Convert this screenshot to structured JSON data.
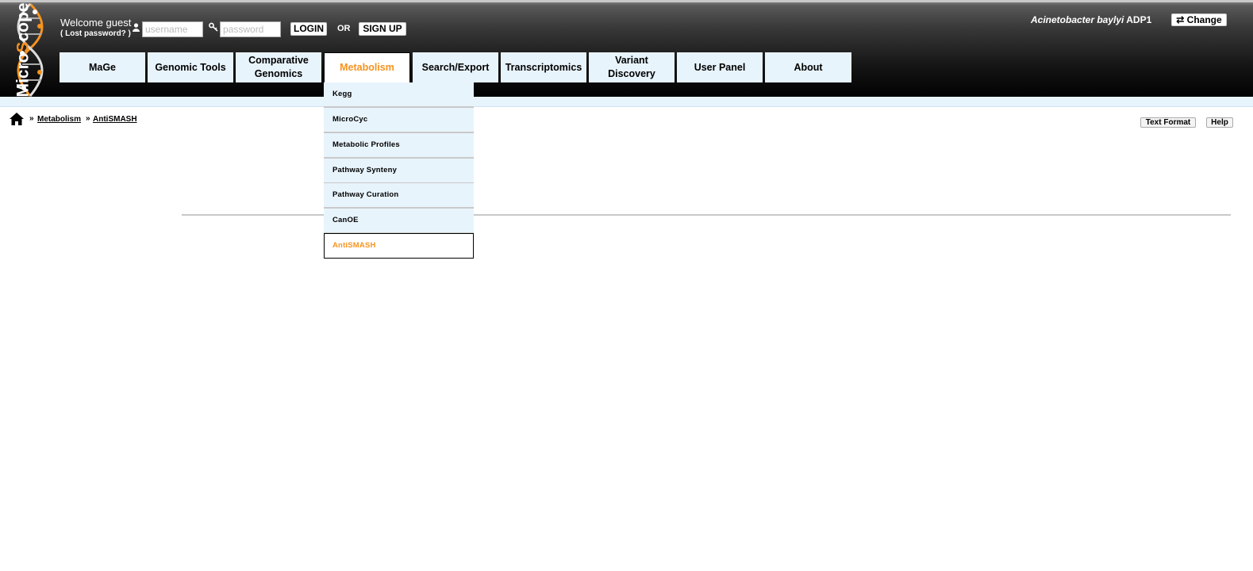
{
  "header": {
    "logo_text_1": "Micro",
    "logo_text_2": "S",
    "logo_text_3": "cope",
    "welcome": "Welcome guest",
    "lost_password": "( Lost password? )",
    "username_placeholder": "username",
    "password_placeholder": "password",
    "login_label": "LOGIN",
    "or_label": "OR",
    "signup_label": "SIGN UP",
    "organism_italic": "Acinetobacter baylyi",
    "organism_strain": " ADP1",
    "change_label": "⇄ Change"
  },
  "nav": {
    "items": [
      {
        "label": "MaGe"
      },
      {
        "label": "Genomic Tools"
      },
      {
        "label": "Comparative Genomics"
      },
      {
        "label": "Metabolism"
      },
      {
        "label": "Search/Export"
      },
      {
        "label": "Transcriptomics"
      },
      {
        "label": "Variant Discovery"
      },
      {
        "label": "User Panel"
      },
      {
        "label": "About"
      }
    ],
    "active": "Metabolism"
  },
  "dropdown": {
    "items": [
      {
        "label": "Kegg"
      },
      {
        "label": "MicroCyc"
      },
      {
        "label": "Metabolic Profiles"
      },
      {
        "label": "Pathway Synteny"
      },
      {
        "label": "Pathway Curation"
      },
      {
        "label": "CanOE"
      },
      {
        "label": "AntiSMASH"
      }
    ],
    "active": "AntiSMASH"
  },
  "breadcrumb": {
    "sep": "»",
    "items": [
      {
        "label": "Metabolism"
      },
      {
        "label": "AntiSMASH"
      }
    ]
  },
  "toolbar": {
    "text_format_label": "Text Format",
    "help_label": "Help"
  },
  "colors": {
    "accent": "#f7931e",
    "nav_bg": "#e8f4fc",
    "header_dark": "#000000"
  }
}
